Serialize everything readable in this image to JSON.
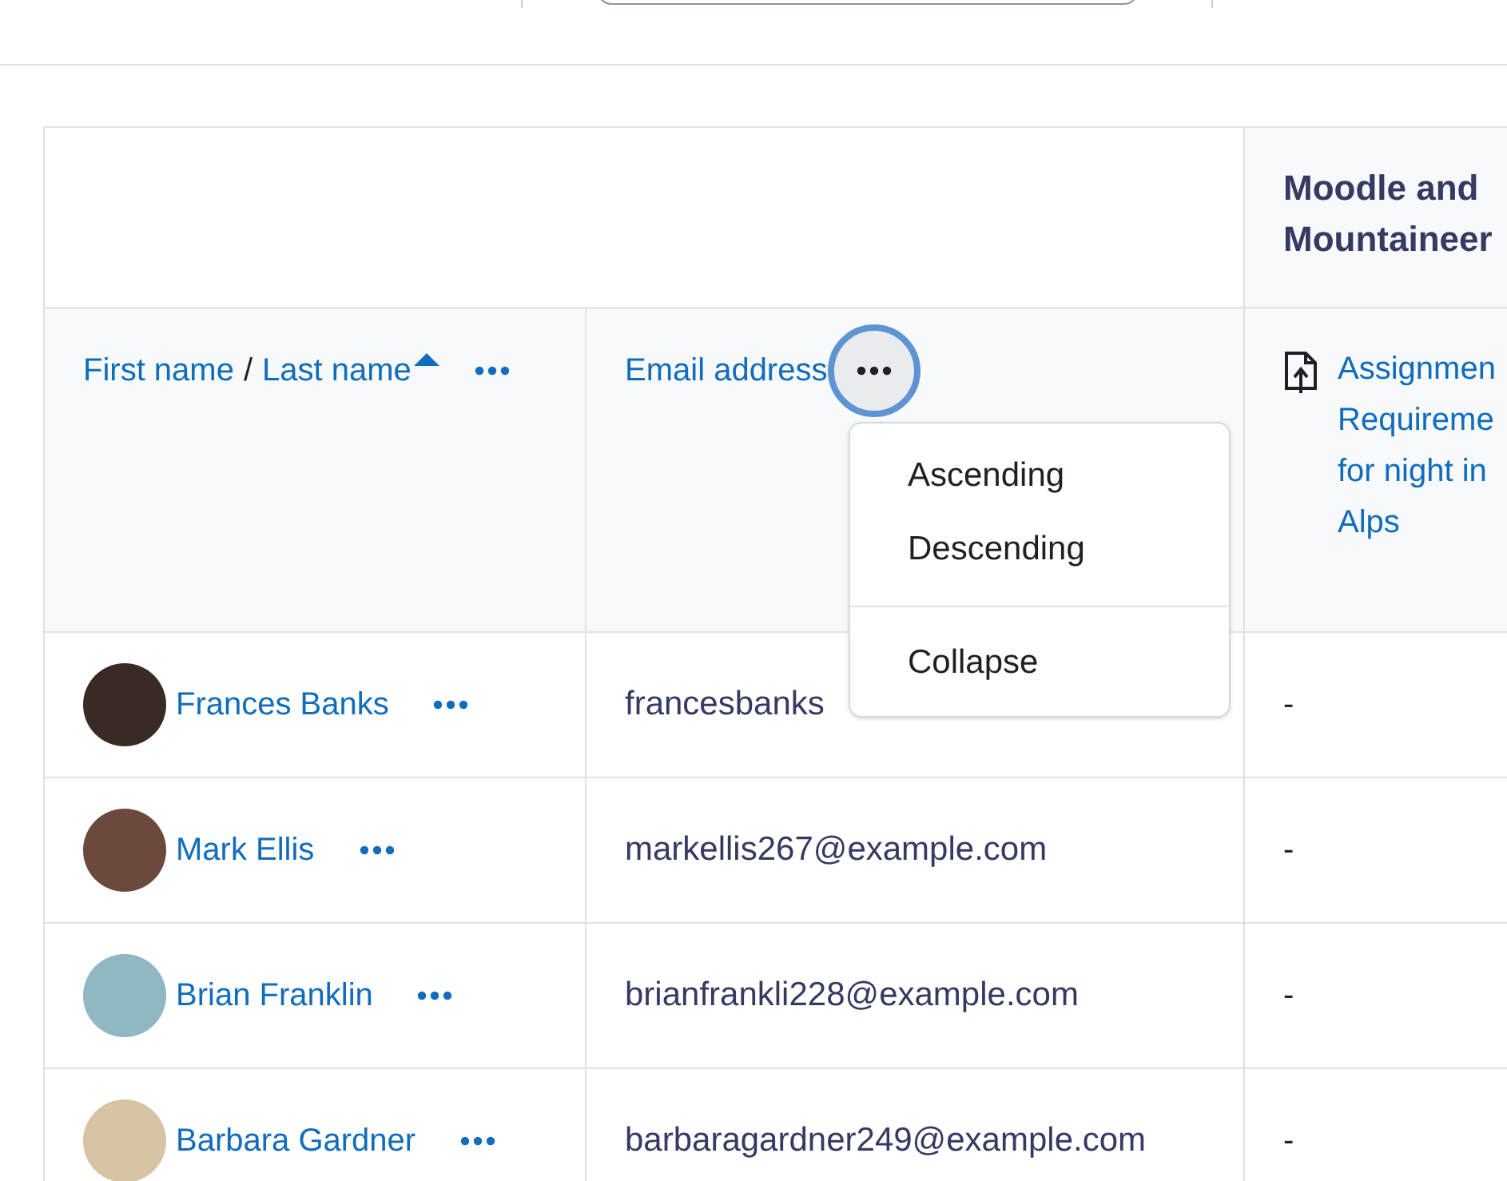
{
  "group_header": {
    "title_lines": [
      "Moodle and",
      "Mountaineer"
    ]
  },
  "columns": [
    {
      "label_parts": [
        "First name",
        "Last name"
      ],
      "separator": "/",
      "sorted_ascending": true,
      "menu_open": false
    },
    {
      "label_parts": [
        "Email address"
      ],
      "sorted_ascending": false,
      "menu_open": true
    },
    {
      "activity_lines": [
        "Assignmen",
        "Requireme",
        "for night in",
        "Alps"
      ]
    }
  ],
  "column_menu": {
    "items": [
      {
        "label": "Ascending",
        "divider_before": false
      },
      {
        "label": "Descending",
        "divider_before": false
      },
      {
        "label": "Collapse",
        "divider_before": true
      }
    ]
  },
  "rows": [
    {
      "name": "Frances Banks",
      "email": "francesbanks",
      "grade": "-",
      "color": "#3a2a26"
    },
    {
      "name": "Mark Ellis",
      "email": "markellis267@example.com",
      "grade": "-",
      "color": "#6b4a3d"
    },
    {
      "name": "Brian Franklin",
      "email": "brianfrankli228@example.com",
      "grade": "-",
      "color": "#8fb7c4"
    },
    {
      "name": "Barbara Gardner",
      "email": "barbaragardner249@example.com",
      "grade": "-",
      "color": "#d8c3a4"
    }
  ]
}
